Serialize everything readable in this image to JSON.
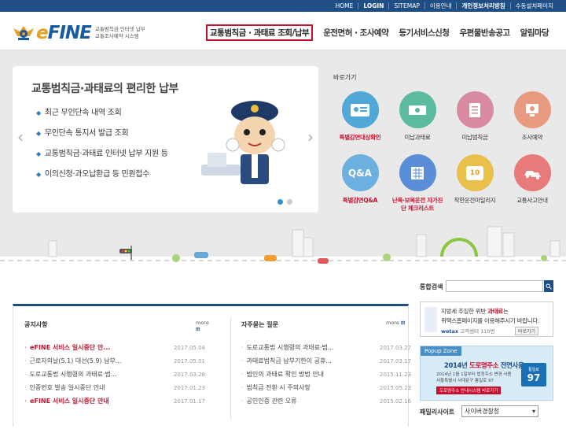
{
  "topbar": {
    "links": [
      "HOME",
      "LOGIN",
      "SITEMAP",
      "이용안내",
      "개인정보처리방침",
      "수동설치페이지"
    ]
  },
  "logo": {
    "text_e": "e",
    "text_fine": "FINE",
    "sub1": "교통범칙금 인터넷 납부",
    "sub2": "교통조사예약 시스템"
  },
  "gnb": [
    "교통범칙금 · 과태료 조회/납부",
    "운전면허 · 조사예약",
    "등기서비스신청",
    "우편물반송공고",
    "알림마당"
  ],
  "banner": {
    "title": "교통범칙금·과태료의 편리한 납부",
    "items": [
      "최근 무인단속 내역 조회",
      "무인단속 통지서 발급 조회",
      "교통범칙금·과태료 인터넷 납부 지원 등",
      "이의신청·과오납환급 등 민원접수"
    ],
    "prev": "‹",
    "next": "›"
  },
  "quick": {
    "title": "바로가기",
    "items": [
      {
        "label": "특별감면대상확인",
        "color": "#4fa8d8",
        "red": true
      },
      {
        "label": "미납과태료",
        "color": "#5cbaa0",
        "red": false
      },
      {
        "label": "미납범칙금",
        "color": "#d88aa0",
        "red": false
      },
      {
        "label": "조사예약",
        "color": "#e89a80",
        "red": false
      },
      {
        "label": "특별감면Q&A",
        "color": "#6cb0e0",
        "red": true
      },
      {
        "label": "난폭·보복운전 자가진단 체크리스트",
        "color": "#5a8fd8",
        "red": true
      },
      {
        "label": "착한운전마일리지",
        "color": "#e8c04a",
        "red": false
      },
      {
        "label": "교통사고안내",
        "color": "#e87a7a",
        "red": false
      }
    ],
    "qa_text": "Q&A",
    "mileage_number": "10"
  },
  "search": {
    "label": "통합검색",
    "placeholder": ""
  },
  "notice": {
    "title": "공지사항",
    "more": "more",
    "rows": [
      {
        "title": "eFINE 서비스 일시중단 안...",
        "date": "2017.05.04",
        "red": true
      },
      {
        "title": "근로자의날(5.1) 대선(5.9) 납부...",
        "date": "2017.05.01",
        "red": false
      },
      {
        "title": "도로교통법 시행령의 과태료·범...",
        "date": "2017.03.28",
        "red": false
      },
      {
        "title": "인증번호 발송 일시중단 안내",
        "date": "2017.01.23",
        "red": false
      },
      {
        "title": "eFINE 서비스 일시중단 안내",
        "date": "2017.01.17",
        "red": true
      }
    ]
  },
  "faq": {
    "title": "자주묻는 질문",
    "more": "more",
    "rows": [
      {
        "title": "도로교통법 시행령의 과태료·범...",
        "date": "2017.03.27"
      },
      {
        "title": "과태료범칙금 납부기한이 공휴...",
        "date": "2017.03.17"
      },
      {
        "title": "범인의 과태료 확인 방법 안내",
        "date": "2015.11.23"
      },
      {
        "title": "범칙금 전환 시 주의사항",
        "date": "2015.05.23"
      },
      {
        "title": "공인인증 관련 오류",
        "date": "2015.02.16"
      }
    ]
  },
  "wetax": {
    "line1_prefix": "지방세 추징한 위반 ",
    "line1_bold": "과태료",
    "line1_suffix": "는",
    "line2": "위택스홈페이지를 이용해주시기 바랍니다.",
    "logo": "wetax",
    "phone": "고객센터 110번",
    "shortcut": "바로가기"
  },
  "popup": {
    "tab": "Popup Zone",
    "line1_prefix": "2014년 ",
    "line1_bold": "도로명주소",
    "line1_suffix": " 전면사용",
    "line2": "2014년 1월 1일부터 법정주소 변경 사용",
    "line3": "서울특별시 서대문구 통일로 97",
    "line4": "도로명주소 안내시스템 바로가기",
    "sign_top": "통일로",
    "sign_num": "97"
  },
  "family": {
    "label": "패밀리사이트",
    "selected": "사이버경찰청"
  },
  "colors": {
    "navy": "#1f4e85",
    "red": "#c8102e",
    "bg": "#e9e9ea"
  }
}
